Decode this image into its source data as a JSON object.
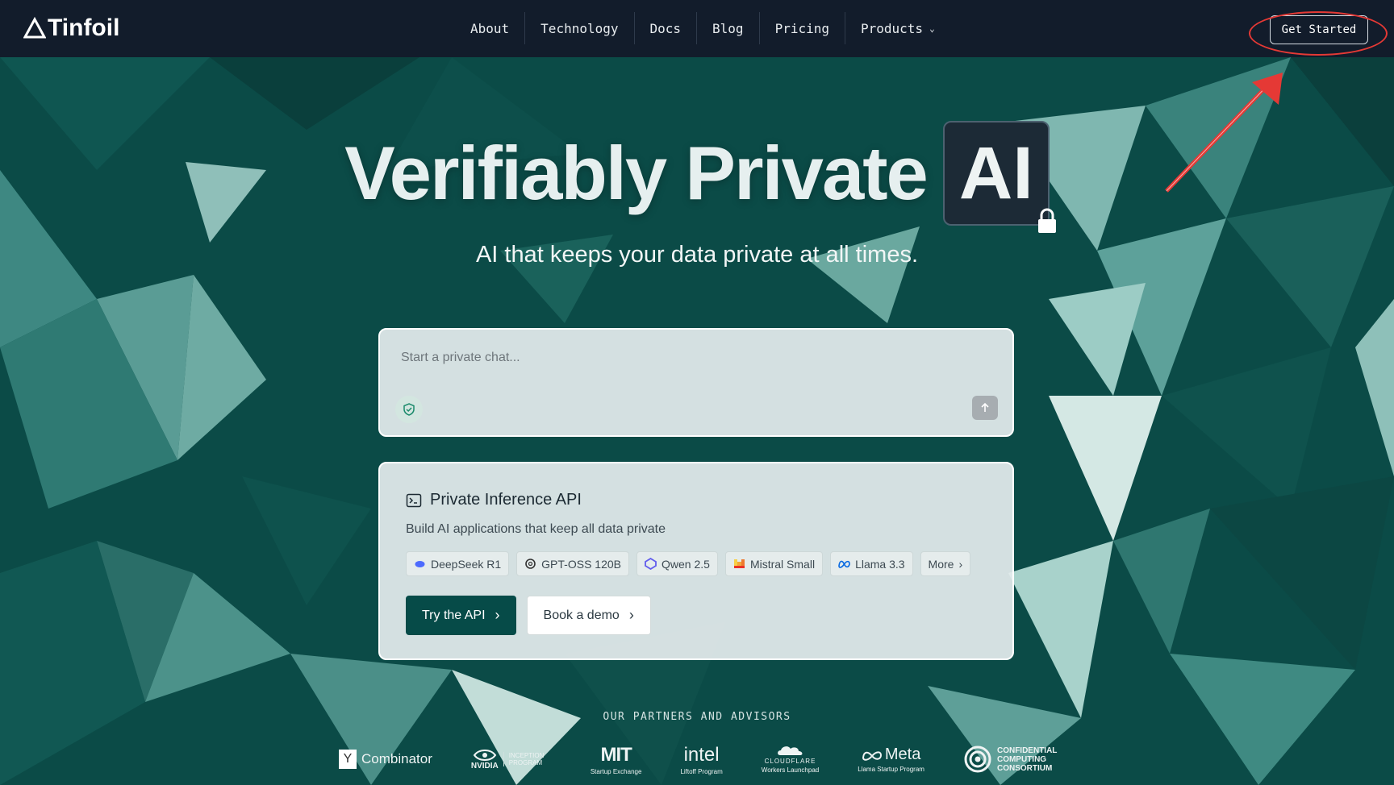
{
  "nav": {
    "brand": "Tinfoil",
    "items": [
      "About",
      "Technology",
      "Docs",
      "Blog",
      "Pricing",
      "Products"
    ],
    "cta": "Get Started"
  },
  "hero": {
    "title": "Verifiably Private",
    "badge": "AI",
    "subtitle": "AI that keeps your data private at all times."
  },
  "chat": {
    "placeholder": "Start a private chat..."
  },
  "api": {
    "title": "Private Inference API",
    "description": "Build AI applications that keep all data private",
    "models": [
      "DeepSeek R1",
      "GPT-OSS 120B",
      "Qwen 2.5",
      "Mistral Small",
      "Llama 3.3",
      "More"
    ],
    "primary_button": "Try the API",
    "secondary_button": "Book a demo"
  },
  "partners": {
    "label": "OUR PARTNERS AND ADVISORS",
    "ycombinator": "Combinator",
    "ycombinator_mark": "Y",
    "nvidia": "NVIDIA",
    "nvidia_program": "INCEPTION PROGRAM",
    "mit": "MIT",
    "mit_sub": "Startup Exchange",
    "intel": "intel",
    "intel_sub": "Liftoff Program",
    "cloudflare": "CLOUDFLARE",
    "cloudflare_sub": "Workers Launchpad",
    "meta": "Meta",
    "meta_sub": "Llama Startup Program",
    "ccc": "CONFIDENTIAL COMPUTING CONSORTIUM"
  },
  "colors": {
    "nav_bg": "#121c2b",
    "hero_bg": "#0c4a46",
    "primary": "#064b48",
    "annotation": "#e53935"
  }
}
